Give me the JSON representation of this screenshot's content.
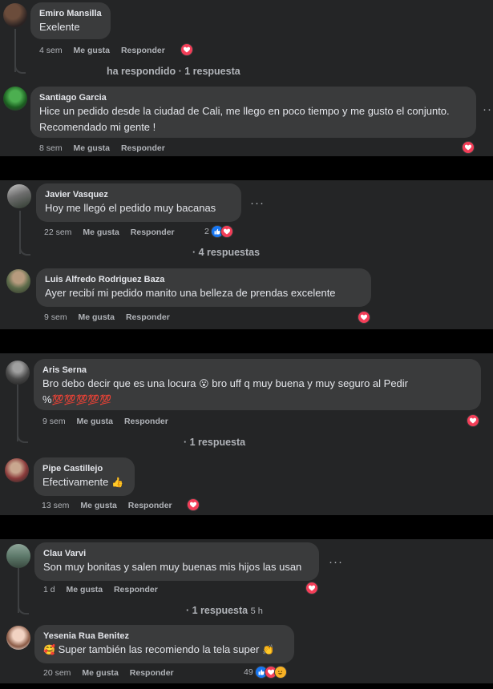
{
  "actions": {
    "like": "Me gusta",
    "reply": "Responder"
  },
  "menu_dots": "···",
  "threads": [
    {
      "comments": [
        {
          "author": "Emiro Mansilla",
          "text": "Exelente",
          "time": "4 sem",
          "reactions": [
            "love"
          ]
        },
        {
          "author": "Santiago Garcia",
          "text": "Hice un pedido desde la ciudad de Cali, me llego en poco tiempo y me gusto el conjunto. Recomendado mi gente !",
          "time": "8 sem",
          "reactions": [
            "love"
          ]
        }
      ],
      "replies_label": "ha respondido · 1 respuesta"
    },
    {
      "comments": [
        {
          "author": "Javier Vasquez",
          "text": "Hoy me llegó el pedido muy bacanas",
          "time": "22 sem",
          "reaction_count": "2",
          "reactions": [
            "like",
            "love"
          ]
        },
        {
          "author": "Luis Alfredo Rodriguez Baza",
          "text": "Ayer recibí mi pedido manito una belleza de prendas excelente",
          "time": "9 sem",
          "reactions": [
            "love"
          ]
        }
      ],
      "replies_label": "· 4 respuestas"
    },
    {
      "comments": [
        {
          "author": "Aris Serna",
          "text_part1": "Bro debo decir que es una locura",
          "emoji_1": "😮",
          "text_part2": "bro uff q muy buena y muy seguro al Pedir %",
          "emoji_2": "💯💯💯💯💯",
          "time": "9 sem",
          "reactions": [
            "love"
          ]
        },
        {
          "author": "Pipe Castillejo",
          "text": "Efectivamente",
          "emoji": "👍",
          "time": "13 sem",
          "reactions": [
            "love"
          ]
        }
      ],
      "replies_label": "· 1 respuesta"
    },
    {
      "comments": [
        {
          "author": "Clau Varvi",
          "text": "Son muy bonitas y salen muy buenas mis hijos las usan",
          "time": "1 d",
          "reactions": [
            "love"
          ]
        },
        {
          "author": "Yesenia Rua Benitez",
          "emoji_1": "🥰",
          "text": "Super también las recomiendo la tela super",
          "emoji_2": "👏",
          "time": "20 sem",
          "reaction_count": "49",
          "reactions": [
            "like",
            "love",
            "haha"
          ]
        }
      ],
      "replies_label": "· 1 respuesta",
      "replies_time": "5 h"
    }
  ]
}
